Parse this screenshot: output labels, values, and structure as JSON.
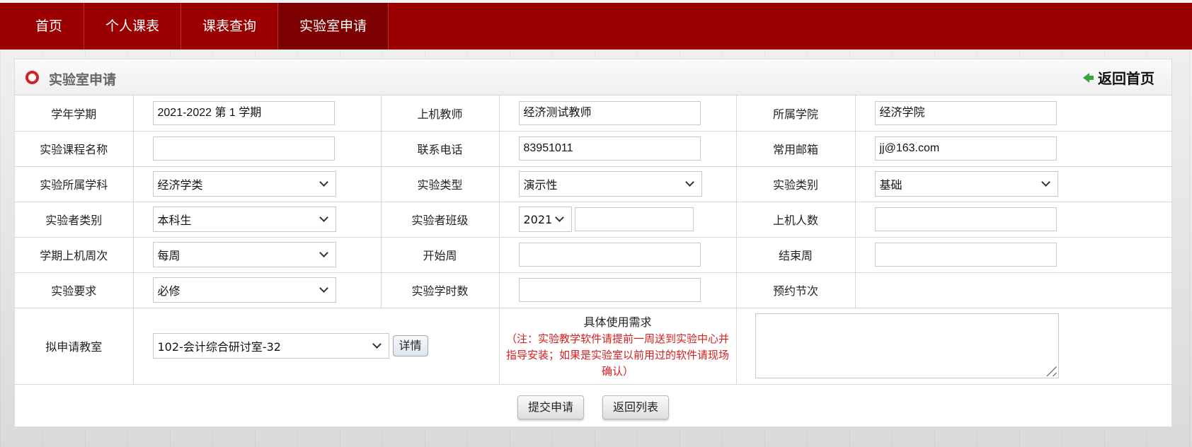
{
  "nav": {
    "items": [
      {
        "label": "首页"
      },
      {
        "label": "个人课表"
      },
      {
        "label": "课表查询"
      },
      {
        "label": "实验室申请"
      }
    ]
  },
  "panel": {
    "title": "实验室申请",
    "back_home": "返回首页"
  },
  "form": {
    "term_label": "学年学期",
    "term_value": "2021-2022 第 1 学期",
    "teacher_label": "上机教师",
    "teacher_value": "经济测试教师",
    "college_label": "所属学院",
    "college_value": "经济学院",
    "course_name_label": "实验课程名称",
    "course_name_value": "",
    "phone_label": "联系电话",
    "phone_value": "83951011",
    "email_label": "常用邮箱",
    "email_value": "jj@163.com",
    "subject_label": "实验所属学科",
    "subject_value": "经济学类",
    "exp_type_label": "实验类型",
    "exp_type_value": "演示性",
    "exp_category_label": "实验类别",
    "exp_category_value": "基础",
    "student_type_label": "实验者类别",
    "student_type_value": "本科生",
    "class_label": "实验者班级",
    "class_year_value": "2021",
    "class_name_value": "",
    "headcount_label": "上机人数",
    "headcount_value": "",
    "frequency_label": "学期上机周次",
    "frequency_value": "每周",
    "start_week_label": "开始周",
    "start_week_value": "",
    "end_week_label": "结束周",
    "end_week_value": "",
    "requirement_label": "实验要求",
    "requirement_value": "必修",
    "hours_label": "实验学时数",
    "hours_value": "",
    "periods_label": "预约节次",
    "room_label": "拟申请教室",
    "room_value": "102-会计综合研讨室-32",
    "room_detail_button": "详情",
    "needs_title": "具体使用需求",
    "needs_note": "（注：实验教学软件请提前一周送到实验中心并指导安装；如果是实验室以前用过的软件请现场确认）"
  },
  "actions": {
    "submit": "提交申请",
    "back_list": "返回列表"
  },
  "colors": {
    "nav_bg": "#9b0000",
    "nav_active": "#7d0000",
    "note_red": "#d42020"
  }
}
